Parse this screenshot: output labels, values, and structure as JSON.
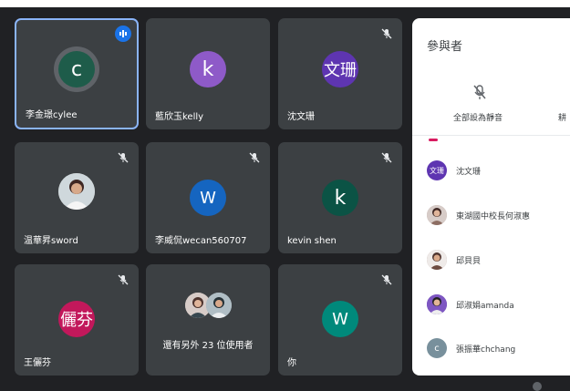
{
  "tiles": [
    {
      "name": "李金璟cylee",
      "initial": "c",
      "avatar_color": "#1e5c4a"
    },
    {
      "name": "藍欣玉kelly",
      "initial": "k",
      "avatar_color": "#8e5ac8"
    },
    {
      "name": "沈文珊",
      "initial": "文珊",
      "avatar_color": "#5e35b1"
    },
    {
      "name": "温華昇sword"
    },
    {
      "name": "李威侃wecan560707",
      "initial": "W",
      "avatar_color": "#1565c0"
    },
    {
      "name": "kevin shen",
      "initial": "k",
      "avatar_color": "#0b5345"
    },
    {
      "name": "王儷芬",
      "initial": "儷芬",
      "avatar_color": "#c2185b"
    },
    {
      "label": "還有另外 23 位使用者"
    },
    {
      "name": "你",
      "initial": "W",
      "avatar_color": "#00897b"
    }
  ],
  "panel": {
    "title": "參與者",
    "mute_all_label": "全部設為靜音",
    "cut_label": "耕",
    "participants": [
      {
        "name": "沈文珊",
        "initial": "文珊",
        "avatar_color": "#5e35b1"
      },
      {
        "name": "東湖國中校長何淑惠"
      },
      {
        "name": "邱貝貝"
      },
      {
        "name": "邱淑娟amanda"
      },
      {
        "name": "張振華chchang",
        "initial": "c",
        "avatar_color": "#78909c"
      }
    ]
  },
  "colors": {
    "tile_bg": "#3c4043",
    "page_bg": "#202124",
    "active_border": "#8ab4f8",
    "speaking": "#1a73e8"
  },
  "icons": [
    "mic-off-icon",
    "speaking-indicator-icon",
    "mute-all-icon"
  ]
}
